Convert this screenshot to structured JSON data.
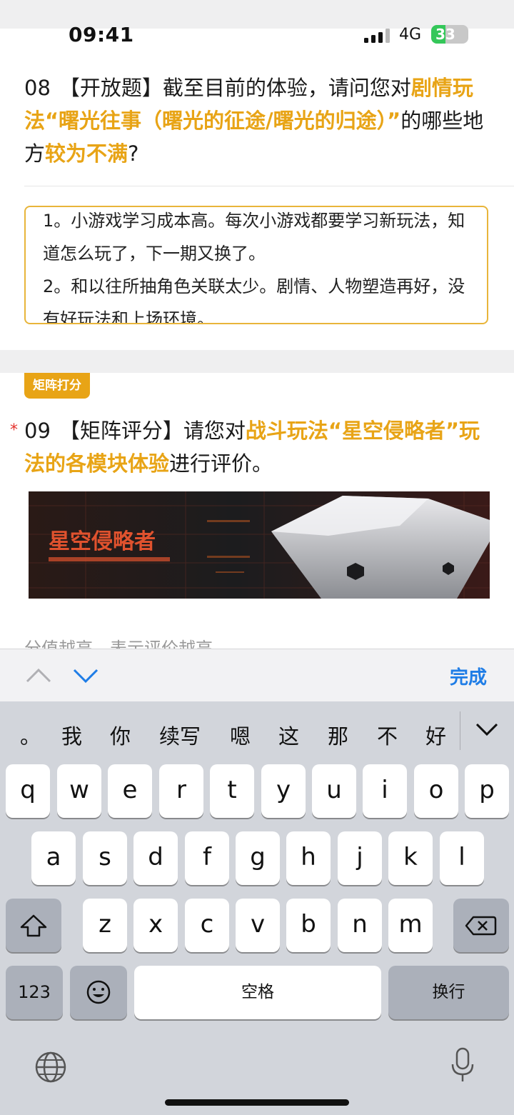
{
  "status": {
    "time": "09:41",
    "network": "4G",
    "battery": "33"
  },
  "q8": {
    "number": "08",
    "part1": "【开放题】截至目前的体验，请问您对",
    "hl1": "剧情玩法“曙光往事（曙光的征途/曙光的归途）”",
    "part2": "的哪些地方",
    "hl2": "较为不满",
    "part3": "?",
    "answer": "1。小游戏学习成本高。每次小游戏都要学习新玩法，知道怎么玩了，下一期又换了。\n2。和以往所抽角色关联太少。剧情、人物塑造再好，没有好玩法和上场环境。"
  },
  "q9": {
    "tag": "矩阵打分",
    "required_mark": "*",
    "number": "09",
    "part1": "【矩阵评分】请您对",
    "hl1": "战斗玩法“星空侵略者”玩法的各模块体验",
    "part2": "进行评价。",
    "banner_title": "星空侵略者",
    "peek_text": "分值越高，表示评价越高"
  },
  "accessory": {
    "done_label": "完成"
  },
  "keyboard": {
    "candidates": [
      "。",
      "我",
      "你",
      "续写",
      "嗯",
      "这",
      "那",
      "不",
      "好"
    ],
    "row1": [
      "q",
      "w",
      "e",
      "r",
      "t",
      "y",
      "u",
      "i",
      "o",
      "p"
    ],
    "row2": [
      "a",
      "s",
      "d",
      "f",
      "g",
      "h",
      "j",
      "k",
      "l"
    ],
    "row3": [
      "z",
      "x",
      "c",
      "v",
      "b",
      "n",
      "m"
    ],
    "numbers_label": "123",
    "space_label": "空格",
    "return_label": "换行"
  },
  "colors": {
    "accent": "#e8a416",
    "link": "#1f7de6",
    "required": "#e5322d"
  }
}
